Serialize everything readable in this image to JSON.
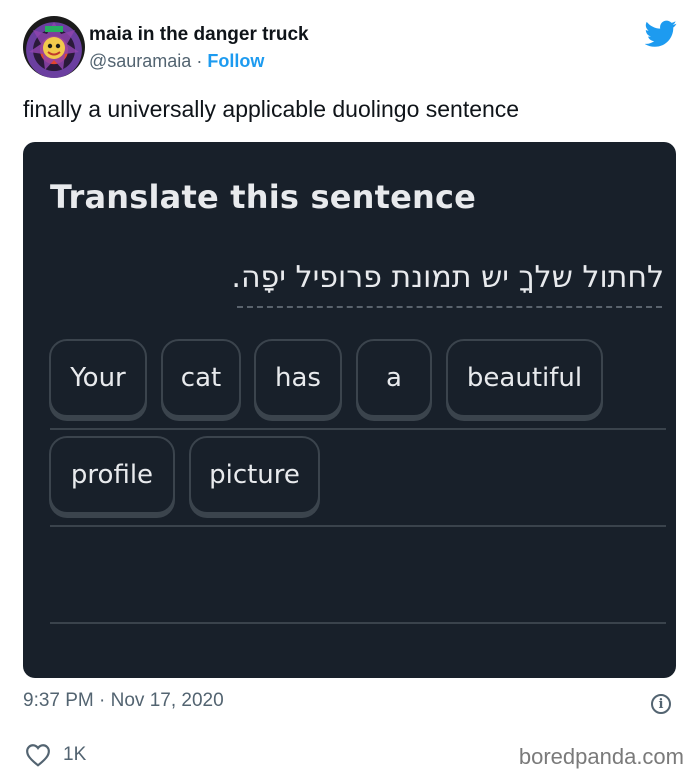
{
  "tweet": {
    "author_name": "maia in the danger truck",
    "handle": "@sauramaia",
    "separator": "·",
    "follow_label": "Follow",
    "text": "finally a universally applicable duolingo sentence",
    "timestamp": "9:37 PM · Nov 17, 2020",
    "likes": "1K"
  },
  "card": {
    "title": "Translate this sentence",
    "hebrew": "לחתול שלךָ יש תמונת פרופיל יפָה.",
    "words": [
      "Your",
      "cat",
      "has",
      "a",
      "beautiful",
      "profile",
      "picture"
    ]
  },
  "credit": "boredpanda.com",
  "colors": {
    "card_bg": "#18202a",
    "accent": "#1d9bf0",
    "muted": "#536471"
  },
  "icons": {
    "brand": "twitter-bird-icon",
    "info": "info-icon",
    "like": "heart-icon"
  }
}
